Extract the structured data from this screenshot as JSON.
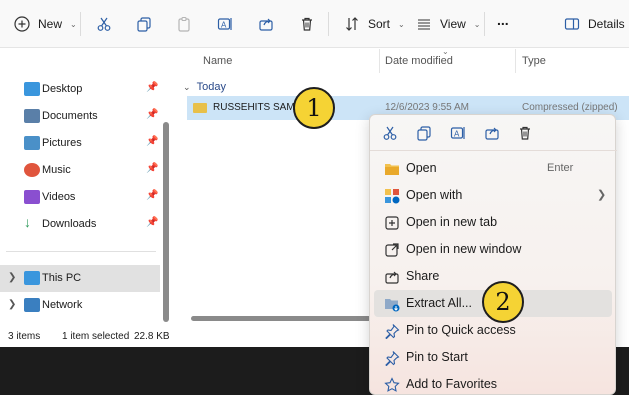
{
  "toolbar": {
    "new_label": "New",
    "sort_label": "Sort",
    "view_label": "View",
    "more_label": "...",
    "details_label": "Details",
    "icons": [
      "cut-icon",
      "copy-icon",
      "paste-icon",
      "rename-icon",
      "share-icon",
      "delete-icon"
    ]
  },
  "nav": {
    "items": [
      {
        "label": "Desktop",
        "icon": "desktop-icon",
        "color": "#3a96dd"
      },
      {
        "label": "Documents",
        "icon": "documents-icon",
        "color": "#5a7fa8"
      },
      {
        "label": "Pictures",
        "icon": "pictures-icon",
        "color": "#4a90c8"
      },
      {
        "label": "Music",
        "icon": "music-icon",
        "color": "#e0553d"
      },
      {
        "label": "Videos",
        "icon": "videos-icon",
        "color": "#8a4fd0"
      },
      {
        "label": "Downloads",
        "icon": "downloads-icon",
        "color": "#2e9a5a"
      }
    ],
    "this_pc": "This PC",
    "network": "Network"
  },
  "content": {
    "headers": {
      "name": "Name",
      "date": "Date modified",
      "type": "Type"
    },
    "group": "Today",
    "file": {
      "name": "RUSSEHITS SAMPLE",
      "date": "12/6/2023 9:55 AM",
      "type": "Compressed (zipped)"
    }
  },
  "status": {
    "count": "3 items",
    "selection": "1 item selected",
    "size": "22.8 KB"
  },
  "menu": {
    "items": [
      {
        "label": "Open",
        "accel": "Enter",
        "icon": "open-folder-icon"
      },
      {
        "label": "Open with",
        "accel": "",
        "icon": "open-with-icon",
        "submenu": true
      },
      {
        "label": "Open in new tab",
        "accel": "",
        "icon": "new-tab-icon"
      },
      {
        "label": "Open in new window",
        "accel": "",
        "icon": "new-window-icon"
      },
      {
        "label": "Share",
        "accel": "",
        "icon": "share-icon"
      },
      {
        "label": "Extract All...",
        "accel": "",
        "icon": "extract-icon"
      },
      {
        "label": "Pin to Quick access",
        "accel": "",
        "icon": "pin-icon"
      },
      {
        "label": "Pin to Start",
        "accel": "",
        "icon": "pin-start-icon"
      },
      {
        "label": "Add to Favorites",
        "accel": "",
        "icon": "star-icon"
      }
    ]
  },
  "callouts": {
    "one": "1",
    "two": "2"
  },
  "colors": {
    "selection": "#cce4f7",
    "badge": "#f5d334",
    "accent": "#0067c0"
  }
}
